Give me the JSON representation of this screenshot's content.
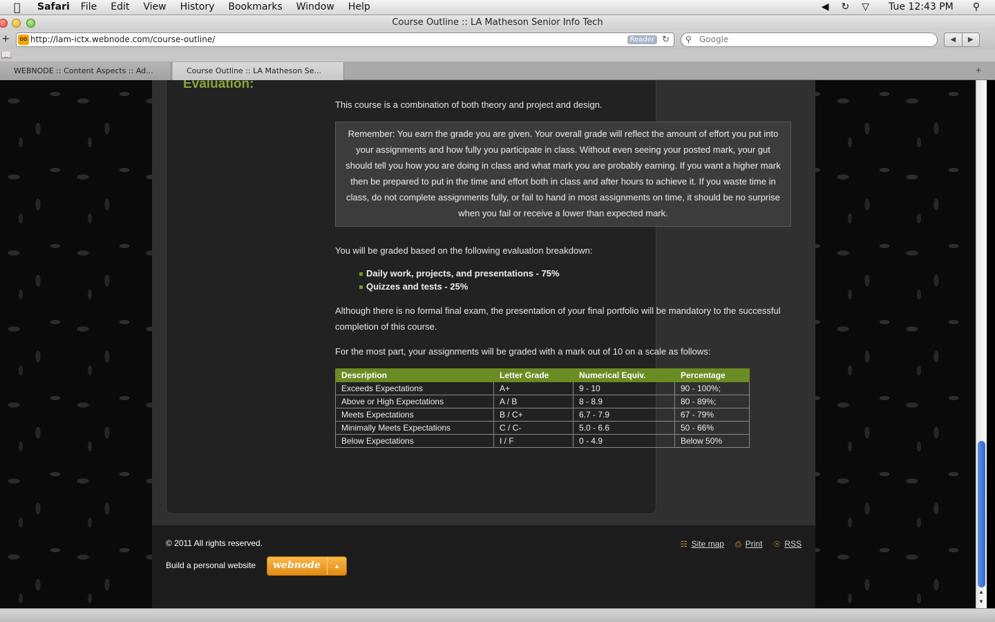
{
  "menubar": {
    "apple": "",
    "app": "Safari",
    "items": [
      "File",
      "Edit",
      "View",
      "History",
      "Bookmarks",
      "Window",
      "Help"
    ],
    "clock": "Tue 12:43 PM"
  },
  "window": {
    "title": "Course Outline :: LA Matheson Senior Info Tech"
  },
  "toolbar": {
    "url": "http://lam-ictx.webnode.com/course-outline/",
    "reader_label": "Reader",
    "search_placeholder": "Google"
  },
  "tabs": [
    {
      "label": "WEBNODE :: Content Aspects :: Ad..."
    },
    {
      "label": "Course Outline :: LA Matheson Se..."
    }
  ],
  "content": {
    "heading": "Evaluation:",
    "intro": "This course is a combination of both theory and project and design.",
    "remember": "Remember: You earn the grade you are given. Your overall grade will reflect the amount of effort you put into your assignments and how fully you participate in class. Without even seeing your posted mark, your gut should tell you how you are doing in class and what mark you are probably earning. If you want a higher mark then be prepared to put in the time and effort both in class and after hours to achieve it. If you waste time in class, do not complete assignments fully, or fail to hand in most assignments on time, it should be no surprise when you fail or receive a lower than expected mark.",
    "breakdown_intro": "You will be graded based on the following evaluation breakdown:",
    "breakdown": [
      "Daily work, projects, and presentations - 75%",
      "Quizzes and tests - 25%"
    ],
    "exam_note": "Although there is no formal final exam, the presentation of your final portfolio will be mandatory to the successful completion of this course.",
    "scale_intro": "For the most part, your assignments will be graded with a mark out of 10 on a scale as follows:",
    "table": {
      "headers": [
        "Description",
        "Letter Grade",
        "Numerical Equiv.",
        "Percentage"
      ],
      "rows": [
        [
          "Exceeds Expectations",
          "A+",
          "9 - 10",
          "90 - 100%;"
        ],
        [
          "Above or High Expectations",
          "A / B",
          "8 - 8.9",
          "80 - 89%;"
        ],
        [
          "Meets Expectations",
          "B / C+",
          "6.7 - 7.9",
          "67 - 79%"
        ],
        [
          "Minimally Meets Expectations",
          "C / C-",
          "5.0 - 6.6",
          "50 - 66%"
        ],
        [
          "Below Expectations",
          "I / F",
          "0 - 4.9",
          "Below 50%"
        ]
      ]
    }
  },
  "footer": {
    "copyright": "© 2011 All rights reserved.",
    "build": "Build a personal website",
    "badge_logo": "webnode",
    "links": [
      "Site map",
      "Print",
      "RSS"
    ]
  },
  "colors": {
    "accent_green": "#6b8b23",
    "heading_green": "#8aa837",
    "badge_orange": "#e9a12c"
  }
}
